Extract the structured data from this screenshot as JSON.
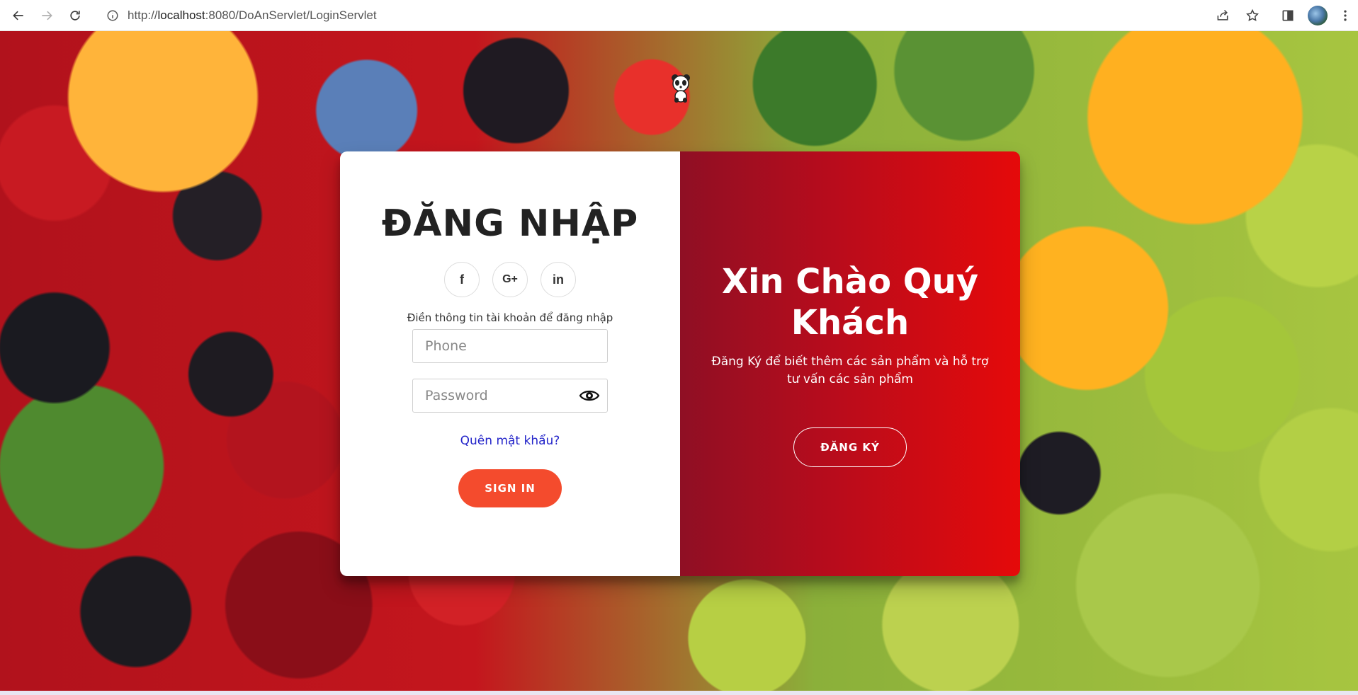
{
  "browser": {
    "url_prefix": "http://",
    "url_host": "localhost",
    "url_rest": ":8080/DoAnServlet/LoginServlet"
  },
  "login": {
    "title": "ĐĂNG NHẬP",
    "social": {
      "facebook": "f",
      "google": "G+",
      "linkedin": "in"
    },
    "helper_text": "Điền thông tin tài khoản để đăng nhập",
    "phone_placeholder": "Phone",
    "phone_value": "",
    "password_placeholder": "Password",
    "password_value": "",
    "forgot_label": "Quên mật khẩu?",
    "signin_label": "SIGN IN"
  },
  "welcome": {
    "title": "Xin Chào Quý Khách",
    "subtitle": "Đăng Ký để biết thêm các sản phẩm và hỗ trợ tư vấn các sản phẩm",
    "register_label": "ĐĂNG KÝ"
  },
  "colors": {
    "signin_button": "#f44b2d",
    "welcome_gradient_start": "#8f0f24",
    "welcome_gradient_end": "#e50a0a",
    "link": "#2324c9"
  },
  "icons": {
    "back": "back-arrow-icon",
    "forward": "forward-arrow-icon",
    "reload": "reload-icon",
    "site_info": "info-icon",
    "share": "share-icon",
    "bookmark": "star-icon",
    "side_panel": "side-panel-icon",
    "menu": "kebab-menu-icon",
    "password_toggle": "eye-icon"
  }
}
